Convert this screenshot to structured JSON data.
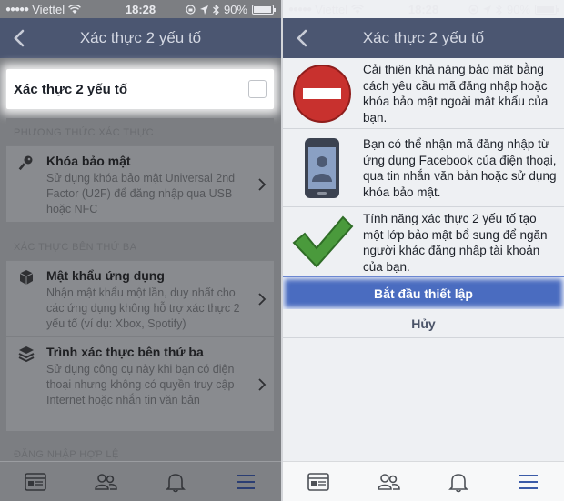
{
  "colors": {
    "nav_bar": "#4b5671",
    "overlay": "#7c7e82",
    "accent_button": "#4a6cc0",
    "check_green": "#4a9a3c",
    "stop_red": "#c8312e"
  },
  "status_bar": {
    "carrier": "Viettel",
    "time": "18:28",
    "battery": "90%"
  },
  "left": {
    "title": "Xác thực 2 yếu tố",
    "toggle": {
      "label": "Xác thực 2 yếu tố",
      "checked": false
    },
    "sections": [
      {
        "header": "PHƯƠNG THỨC XÁC THỰC",
        "rows": [
          {
            "icon": "key-icon",
            "title": "Khóa bảo mật",
            "description": "Sử dụng khóa bảo mật Universal 2nd Factor (U2F) để đăng nhập qua USB hoặc NFC"
          }
        ]
      },
      {
        "header": "XÁC THỰC BÊN THỨ BA",
        "rows": [
          {
            "icon": "cube-icon",
            "title": "Mật khẩu ứng dụng",
            "description": "Nhận mật khẩu một lần, duy nhất cho các ứng dụng không hỗ trợ xác thực 2 yếu tố (ví dụ: Xbox, Spotify)"
          },
          {
            "icon": "layers-icon",
            "title": "Trình xác thực bên thứ ba",
            "description": "Sử dụng công cụ này khi bạn có điện thoại nhưng không có quyền truy cập Internet hoặc nhắn tin văn bản"
          }
        ]
      },
      {
        "header": "ĐĂNG NHẬP HỢP LỆ",
        "rows": []
      }
    ]
  },
  "right": {
    "title": "Xác thực 2 yếu tố",
    "info": [
      {
        "icon": "no-entry-icon",
        "text": "Cải thiện khả năng bảo mật bằng cách yêu cầu mã đăng nhập hoặc khóa bảo mật ngoài mật khẩu của bạn."
      },
      {
        "icon": "phone-icon",
        "text": "Bạn có thể nhận mã đăng nhập từ ứng dụng Facebook của điện thoại, qua tin nhắn văn bản hoặc sử dụng khóa bảo mật."
      },
      {
        "icon": "checkmark-icon",
        "text": "Tính năng xác thực 2 yếu tố tạo một lớp bảo mật bổ sung để ngăn người khác đăng nhập tài khoản của bạn."
      }
    ],
    "primary_button": "Bắt đầu thiết lập",
    "cancel_button": "Hủy"
  },
  "tabbar": [
    "news-feed-icon",
    "friends-icon",
    "notifications-icon",
    "menu-icon"
  ]
}
